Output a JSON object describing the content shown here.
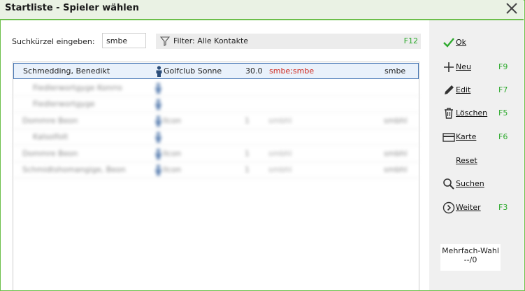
{
  "window": {
    "title": "Startliste - Spieler wählen"
  },
  "search": {
    "label": "Suchkürzel eingeben:",
    "value": "smbe"
  },
  "filter": {
    "text": "Filter: Alle Kontakte",
    "key": "F12"
  },
  "list": {
    "selected": {
      "name": "Schmedding, Benedikt",
      "club": "Golfclub Sonne",
      "hcp": "30.0",
      "code": "smbe;smbe",
      "short": "smbe"
    },
    "blurred_rows": [
      {
        "name": "Fiedlerwortgyge Konrro",
        "club": "",
        "hcp": "",
        "code": "",
        "short": ""
      },
      {
        "name": "Fiedlerwortgyge",
        "club": "",
        "hcp": "",
        "code": "",
        "short": ""
      },
      {
        "name": "Dommre Beon",
        "club": "Ilcon",
        "hcp": "1",
        "code": "smbhl",
        "short": "smbhl"
      },
      {
        "name": "Kalsolfolt",
        "club": "",
        "hcp": "",
        "code": "",
        "short": ""
      },
      {
        "name": "Dommre Beon",
        "club": "Ilcon",
        "hcp": "1",
        "code": "smbhl",
        "short": "smbhl"
      },
      {
        "name": "Schmidtshomangige, Beon",
        "club": "Ilcon",
        "hcp": "1",
        "code": "smbhl",
        "short": "smbhl"
      }
    ]
  },
  "sidebar": {
    "buttons": [
      {
        "name": "ok",
        "label": "Ok",
        "key": "",
        "icon": "check-icon"
      },
      {
        "name": "neu",
        "label": "Neu",
        "key": "F9",
        "icon": "plus-icon"
      },
      {
        "name": "edit",
        "label": "Edit",
        "key": "F7",
        "icon": "pencil-icon"
      },
      {
        "name": "loeschen",
        "label": "Löschen",
        "key": "F5",
        "icon": "trash-icon"
      },
      {
        "name": "karte",
        "label": "Karte",
        "key": "F6",
        "icon": "card-icon"
      },
      {
        "name": "reset",
        "label": "Reset",
        "key": "",
        "icon": ""
      },
      {
        "name": "suchen",
        "label": "Suchen",
        "key": "",
        "icon": "search-icon"
      },
      {
        "name": "weiter",
        "label": "Weiter",
        "key": "F3",
        "icon": "arrow-right-circle-icon"
      }
    ],
    "multi": {
      "title": "Mehrfach-Wahl",
      "count": "--/0"
    }
  },
  "colors": {
    "accent": "#6cbf4a",
    "key_green": "#2eaa2e",
    "code_red": "#d0281e",
    "selection_border": "#4b7ab7"
  }
}
